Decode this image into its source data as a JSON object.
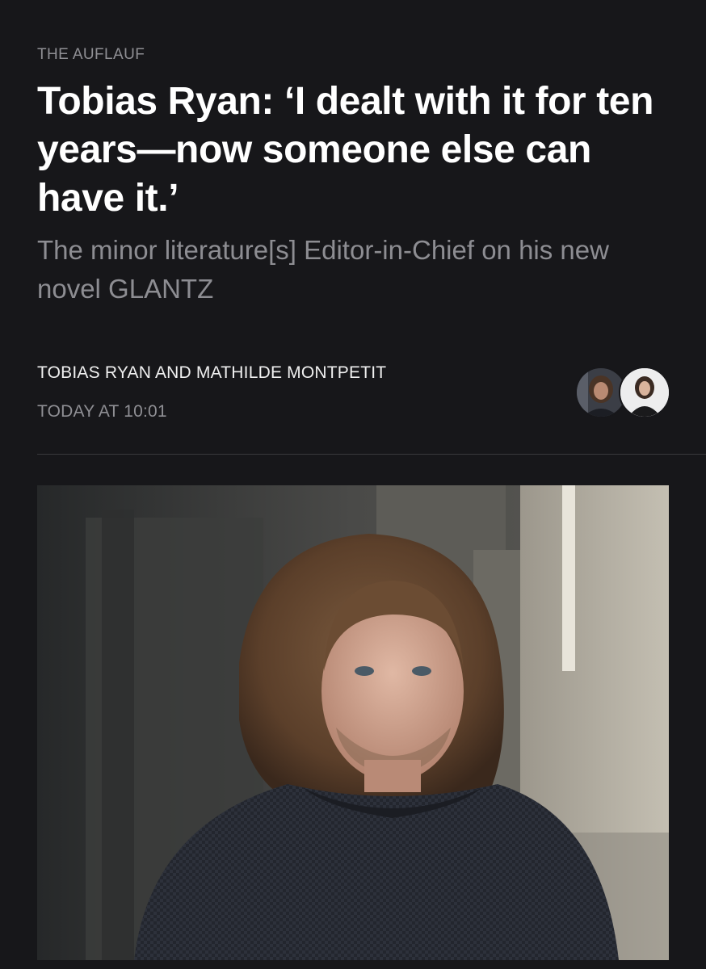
{
  "article": {
    "kicker": "THE AUFLAUF",
    "headline": "Tobias Ryan: ‘I dealt with it for ten years—now someone else can have it.’",
    "subtitle": "The minor literature[s] Editor-in-Chief on his new novel GLANTZ",
    "authors": "TOBIAS RYAN AND MATHILDE MONTPETIT",
    "timestamp": "TODAY AT 10:01"
  },
  "colors": {
    "background": "#17171a",
    "headline": "#ffffff",
    "muted": "#8d8d92",
    "divider": "#38383c"
  },
  "icons": [
    "author-avatar-1",
    "author-avatar-2"
  ]
}
